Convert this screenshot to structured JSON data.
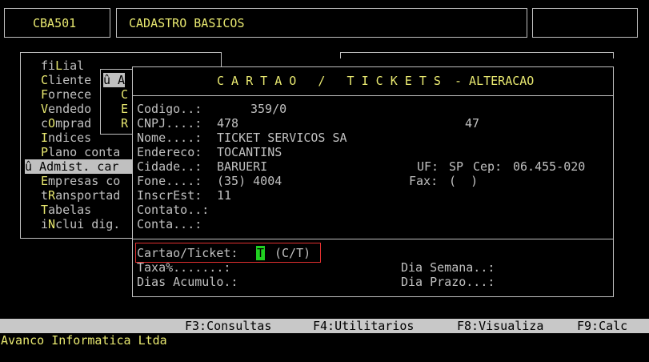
{
  "header": {
    "program_code": "CBA501",
    "title": "CADASTRO BASICOS"
  },
  "menu": {
    "items": [
      {
        "hotkey": "L",
        "pre": "fi",
        "post": "ial"
      },
      {
        "hotkey": "C",
        "pre": "",
        "post": "liente"
      },
      {
        "hotkey": "F",
        "pre": "",
        "post": "ornece"
      },
      {
        "hotkey": "V",
        "pre": "",
        "post": "endedo"
      },
      {
        "hotkey": "O",
        "pre": "c",
        "post": "mprad"
      },
      {
        "hotkey": "I",
        "pre": "",
        "post": "ndices"
      },
      {
        "hotkey": "P",
        "pre": "",
        "post": "lano conta"
      },
      {
        "hotkey": "",
        "pre": "û Admist. car",
        "post": ""
      },
      {
        "hotkey": "E",
        "pre": "",
        "post": "mpresas co"
      },
      {
        "hotkey": "R",
        "pre": "t",
        "post": "ansportad"
      },
      {
        "hotkey": "T",
        "pre": "",
        "post": "abelas"
      },
      {
        "hotkey": "N",
        "pre": "i",
        "post": "clui dig."
      }
    ],
    "submenu": [
      "û A",
      "C",
      "E",
      "R"
    ]
  },
  "dialog": {
    "title": "C A R T A O   /   T I C K E T S",
    "mode": "- ALTERACAO",
    "fields": {
      "codigo_label": "Codigo..:",
      "codigo_value": "359/0",
      "cnpj_label": "CNPJ....:",
      "cnpj_value": "478",
      "cnpj_suffix": "47",
      "nome_label": "Nome....:",
      "nome_value": "TICKET SERVICOS SA",
      "endereco_label": "Endereco:",
      "endereco_value": "TOCANTINS",
      "cidade_label": "Cidade..:",
      "cidade_value": "BARUERI",
      "uf_label": "UF:",
      "uf_value": "SP",
      "cep_label": "Cep:",
      "cep_value": "06.455-020",
      "fone_label": "Fone....:",
      "fone_value": "(35) 4004",
      "fax_label": "Fax:",
      "fax_value": "(  )",
      "inscr_label": "InscrEst:",
      "inscr_value": "11",
      "contato_label": "Contato..:",
      "conta_label": "Conta...:",
      "cartao_label": "Cartao/Ticket:",
      "cartao_value": "T",
      "cartao_hint": "(C/T)",
      "taxa_label": "Taxa%.......:",
      "dia_semana_label": "Dia Semana..:",
      "dias_acumulo_label": "Dias Acumulo.:",
      "dia_prazo_label": "Dia Prazo...:"
    }
  },
  "status_bar": {
    "f3": "F3:Consultas",
    "f4": "F4:Utilitarios",
    "f8": "F8:Visualiza",
    "f9": "F9:Calc"
  },
  "footer": {
    "company": "Avanco Informatica Ltda"
  },
  "colors": {
    "background": "#000000",
    "text": "#c0c0c0",
    "highlight": "#e8e870",
    "field_cursor": "#20d020",
    "focus_outline": "#e03030",
    "status_bar": "#c8c8c8"
  }
}
